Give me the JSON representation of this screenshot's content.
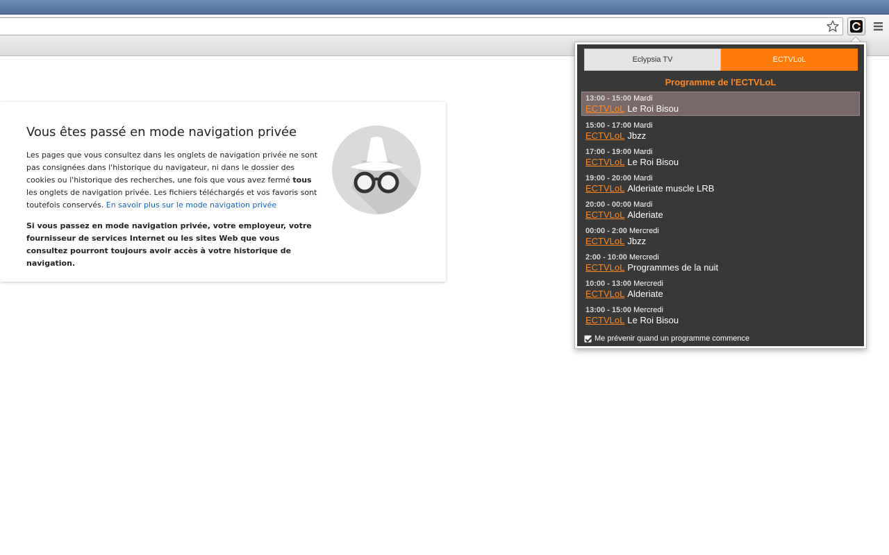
{
  "toolbar": {
    "star_icon": "star-icon",
    "extension_icon": "eclypsia-c-icon",
    "menu_icon": "hamburger-menu-icon"
  },
  "incognito": {
    "title": "Vous êtes passé en mode navigation privée",
    "p1_a": "Les pages que vous consultez dans les onglets de navigation privée ne sont pas consignées dans l'historique du navigateur, ni dans le dossier des cookies ou l'historique des recherches, une fois que vous avez fermé ",
    "p1_bold": "tous",
    "p1_b": " les onglets de navigation privée. Les fichiers téléchargés et vos favoris sont toutefois conservés. ",
    "learn_more": "En savoir plus sur le mode navigation privée",
    "p2": "Si vous passez en mode navigation privée, votre employeur, votre fournisseur de services Internet ou les sites Web que vous consultez pourront toujours avoir accès à votre historique de navigation.",
    "icon": "incognito-spy-icon"
  },
  "popup": {
    "tabs": [
      "Eclypsia TV",
      "ECTVLoL"
    ],
    "active_tab": "ECTVLoL",
    "program_title": "Programme de l'ECTVLoL",
    "items": [
      {
        "time": "13:00 - 15:00",
        "day": "Mardi",
        "channel": "ECTVLoL",
        "show": "Le Roi Bisou"
      },
      {
        "time": "15:00 - 17:00",
        "day": "Mardi",
        "channel": "ECTVLoL",
        "show": "Jbzz"
      },
      {
        "time": "17:00 - 19:00",
        "day": "Mardi",
        "channel": "ECTVLoL",
        "show": "Le Roi Bisou"
      },
      {
        "time": "19:00 - 20:00",
        "day": "Mardi",
        "channel": "ECTVLoL",
        "show": "Alderiate muscle LRB"
      },
      {
        "time": "20:00 - 00:00",
        "day": "Mardi",
        "channel": "ECTVLoL",
        "show": "Alderiate"
      },
      {
        "time": "00:00 - 2:00",
        "day": "Mercredi",
        "channel": "ECTVLoL",
        "show": "Jbzz"
      },
      {
        "time": "2:00 - 10:00",
        "day": "Mercredi",
        "channel": "ECTVLoL",
        "show": "Programmes de la nuit"
      },
      {
        "time": "10:00 - 13:00",
        "day": "Mercredi",
        "channel": "ECTVLoL",
        "show": "Alderiate"
      },
      {
        "time": "13:00 - 15:00",
        "day": "Mercredi",
        "channel": "ECTVLoL",
        "show": "Le Roi Bisou"
      }
    ],
    "notify_label": "Me prévenir quand un programme commence",
    "notify_checked": true,
    "accent": "#ff7c0a"
  }
}
